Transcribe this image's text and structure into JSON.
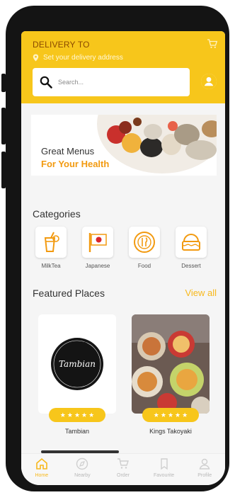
{
  "header": {
    "title": "DELIVERY TO",
    "address_label": "Set your delivery address",
    "search_placeholder": "Search..."
  },
  "banner": {
    "line1": "Great Menus",
    "line2": "For Your Health"
  },
  "categories": {
    "title": "Categories",
    "items": [
      {
        "label": "MilkTea",
        "icon": "milk-tea-icon"
      },
      {
        "label": "Japanese",
        "icon": "japan-flag-icon"
      },
      {
        "label": "Food",
        "icon": "plate-cutlery-icon"
      },
      {
        "label": "Dessert",
        "icon": "cake-icon"
      }
    ]
  },
  "featured": {
    "title": "Featured Places",
    "view_all": "View all",
    "places": [
      {
        "name": "Tambian",
        "logo_text": "Tambian",
        "rating": 5
      },
      {
        "name": "Kings Takoyaki",
        "rating": 5
      }
    ]
  },
  "nav": {
    "items": [
      {
        "label": "Home",
        "icon": "home-icon",
        "active": true
      },
      {
        "label": "Nearby",
        "icon": "compass-icon",
        "active": false
      },
      {
        "label": "Order",
        "icon": "cart-icon",
        "active": false
      },
      {
        "label": "Favourite",
        "icon": "bookmark-icon",
        "active": false
      },
      {
        "label": "Profile",
        "icon": "user-icon",
        "active": false
      }
    ]
  },
  "colors": {
    "accent": "#f7c61b",
    "accent_text": "#f29a10"
  }
}
